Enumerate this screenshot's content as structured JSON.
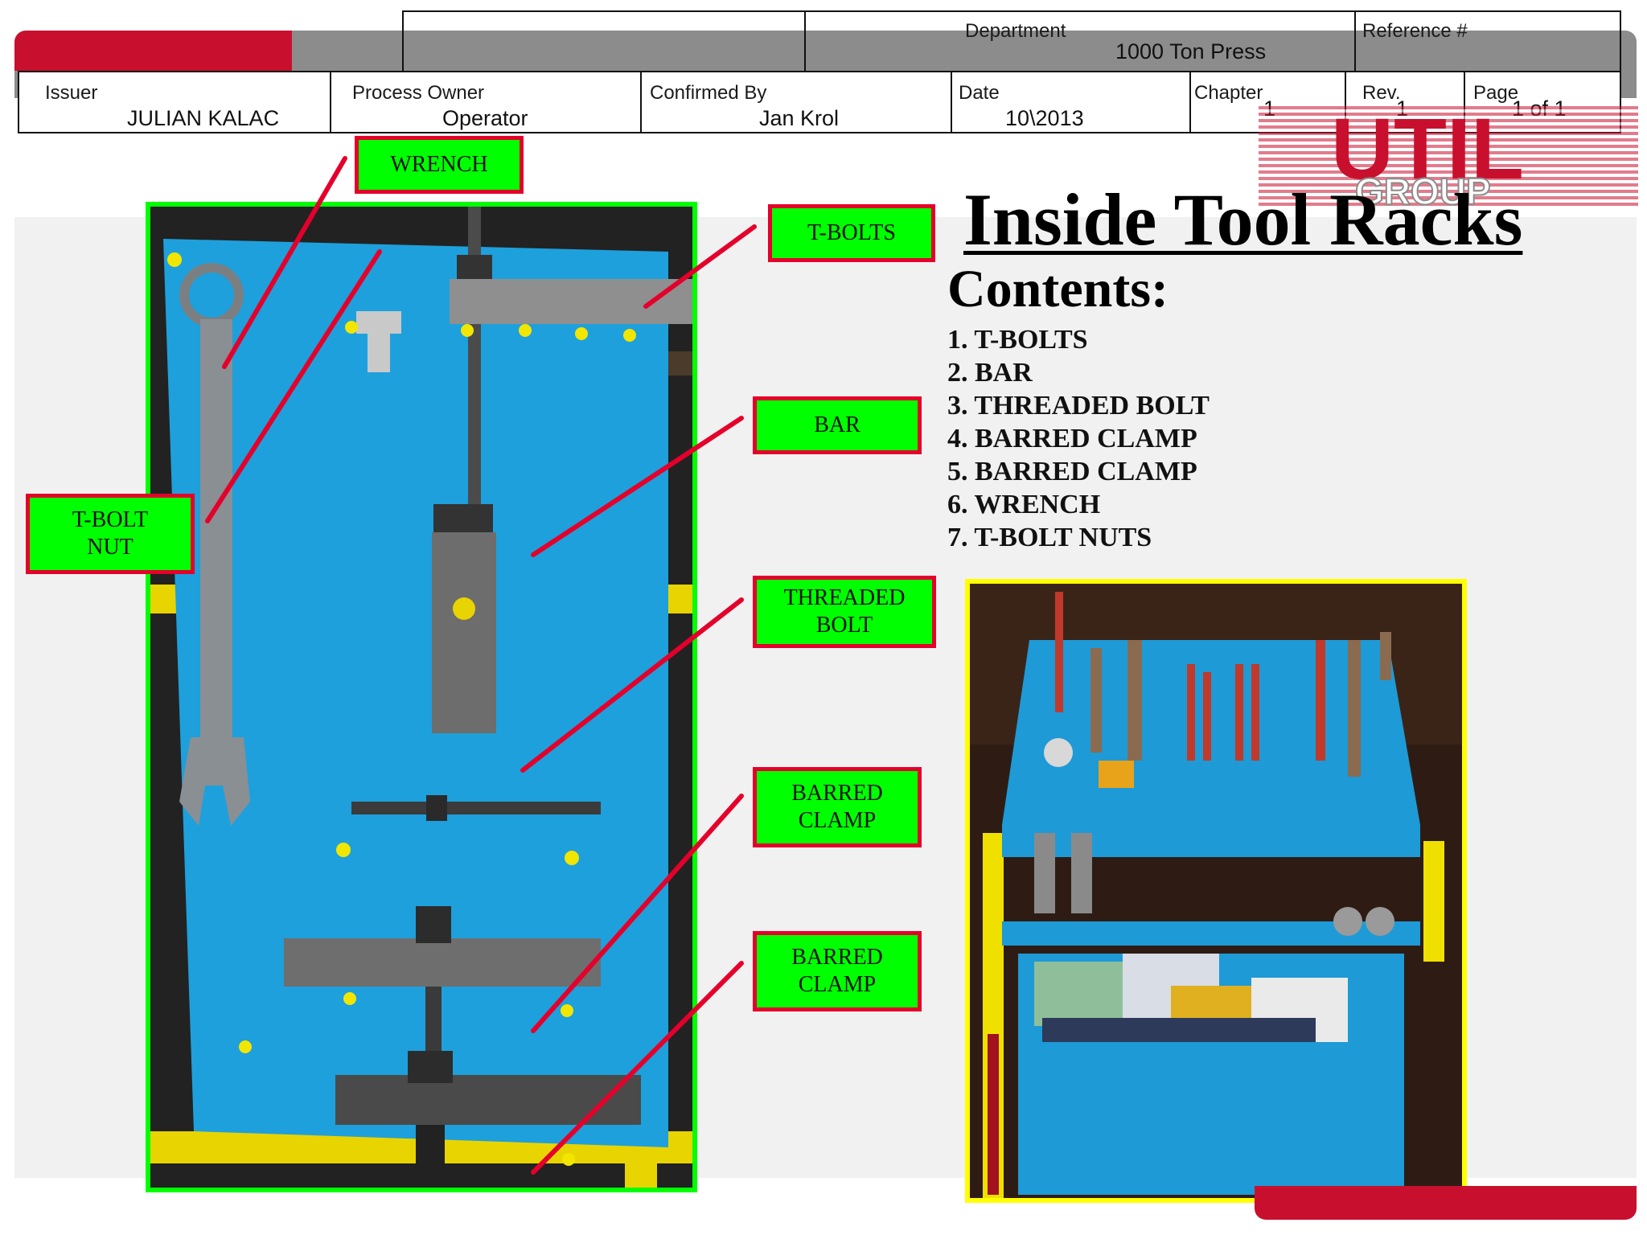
{
  "header": {
    "department_label": "Department",
    "department_value": "1000 Ton Press",
    "reference_label": "Reference #",
    "reference_value": "",
    "issuer_label": "Issuer",
    "issuer_value": "JULIAN KALAC",
    "process_owner_label": "Process Owner",
    "process_owner_value": "Operator",
    "confirmed_by_label": "Confirmed By",
    "confirmed_by_value": "Jan Krol",
    "date_label": "Date",
    "date_value": "10\\2013",
    "chapter_label": "Chapter",
    "chapter_value": "1",
    "rev_label": "Rev.",
    "rev_value": "1",
    "page_label": "Page",
    "page_value": "1 of 1"
  },
  "logo": {
    "top": "UTIL",
    "bottom": "GROUP",
    "color": "#c8102e"
  },
  "title": "Inside Tool Racks",
  "contents_heading": "Contents:",
  "contents": [
    "1. T-BOLTS",
    "2. BAR",
    "3. THREADED BOLT",
    "4. BARRED CLAMP",
    "5. BARRED CLAMP",
    "6. WRENCH",
    "7. T-BOLT NUTS"
  ],
  "callouts": {
    "wrench": "WRENCH",
    "t_bolt_nut": "T-BOLT\nNUT",
    "t_bolts": "T-BOLTS",
    "bar": "BAR",
    "threaded_bolt": "THREADED\nBOLT",
    "barred_clamp_1": "BARRED\nCLAMP",
    "barred_clamp_2": "BARRED\nCLAMP"
  },
  "colors": {
    "accent_red": "#c8102e",
    "header_grey": "#8c8c8c",
    "label_green": "#00ff00",
    "leader_red": "#e4002b",
    "rack_blue": "#1ea0dc",
    "frame_green": "#00ff00",
    "frame_yellow": "#ffff00"
  }
}
